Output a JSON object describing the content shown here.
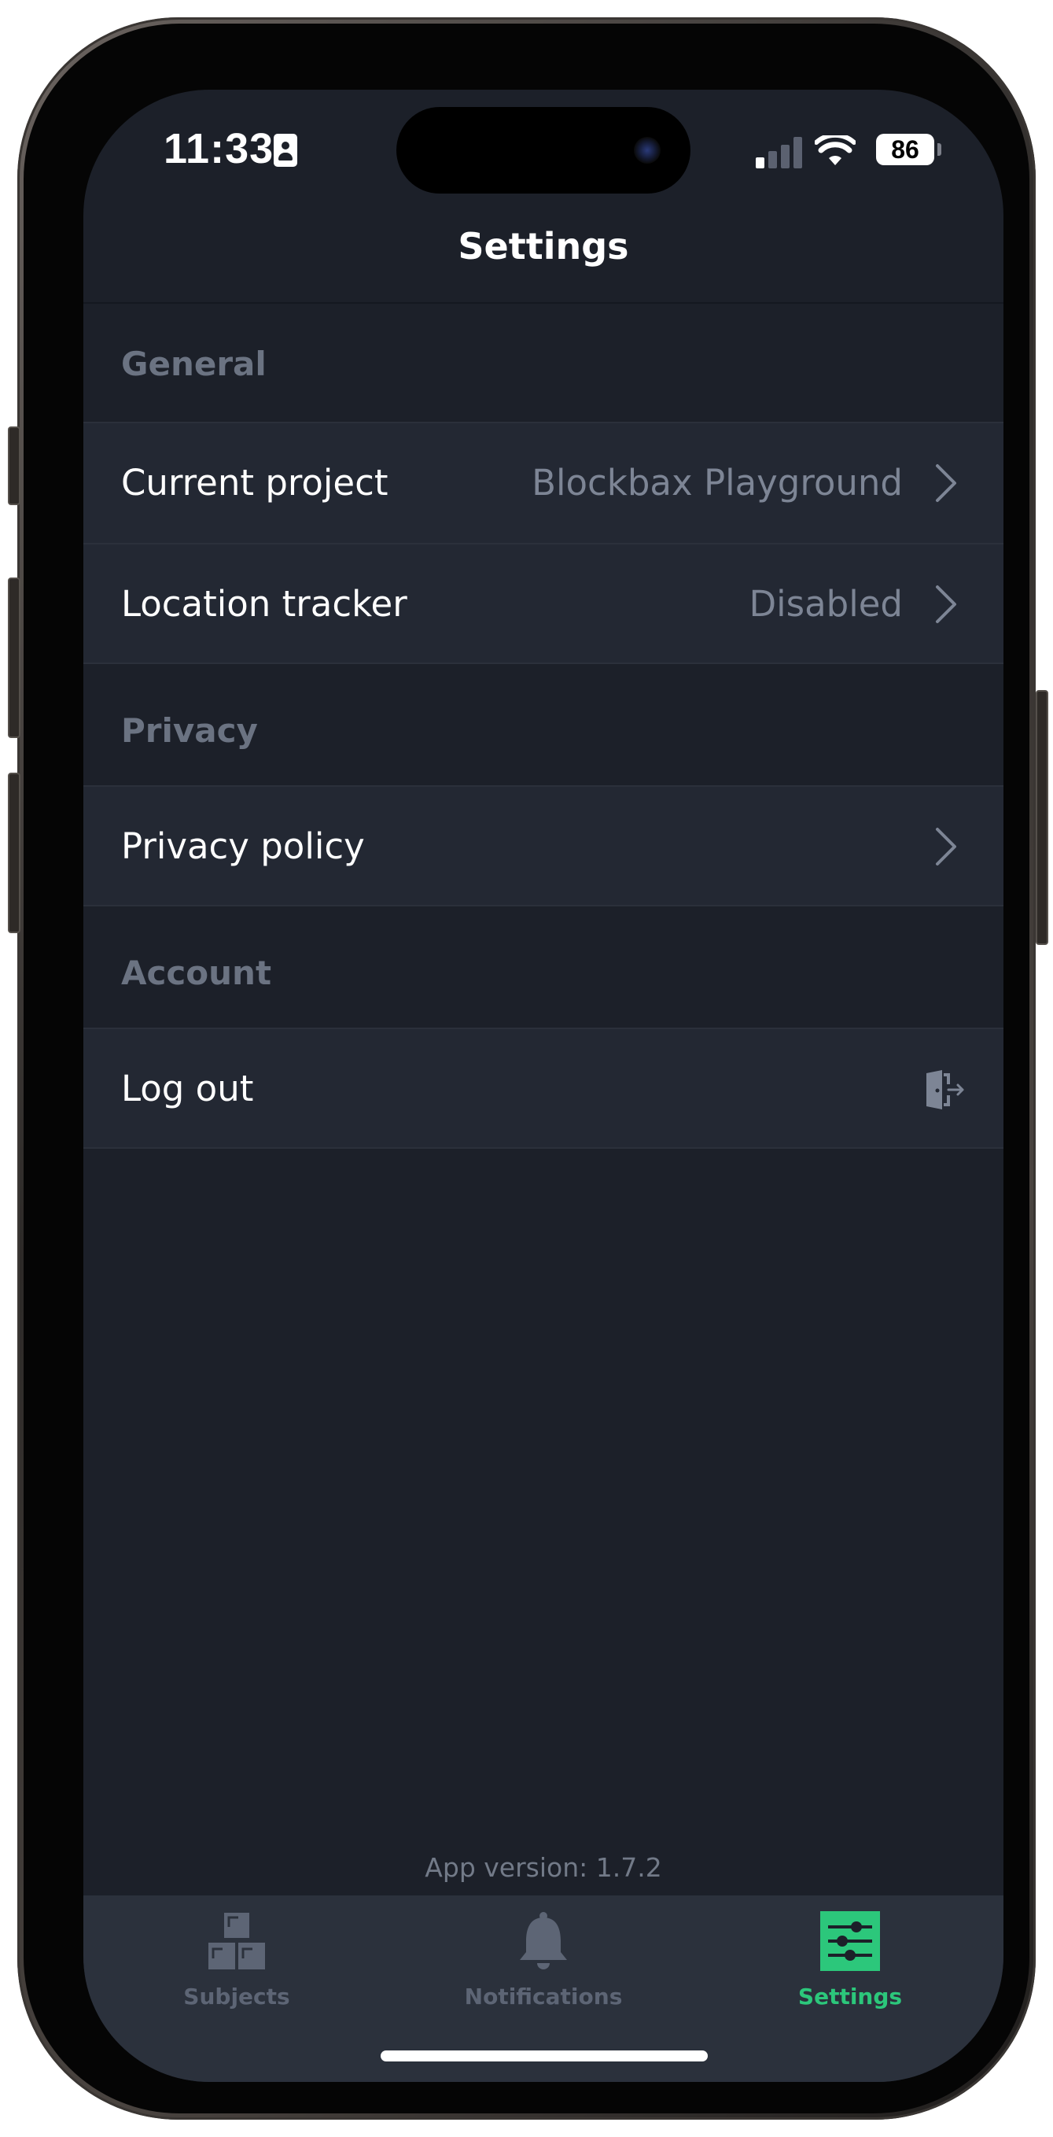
{
  "status_bar": {
    "time": "11:33",
    "battery": "86"
  },
  "header": {
    "title": "Settings"
  },
  "sections": {
    "general": {
      "title": "General",
      "current_project": {
        "label": "Current project",
        "value": "Blockbax Playground"
      },
      "location_tracker": {
        "label": "Location tracker",
        "value": "Disabled"
      }
    },
    "privacy": {
      "title": "Privacy",
      "privacy_policy": {
        "label": "Privacy policy"
      }
    },
    "account": {
      "title": "Account",
      "log_out": {
        "label": "Log out"
      }
    }
  },
  "footer": {
    "app_version": "App version: 1.7.2"
  },
  "tabbar": {
    "tabs": [
      {
        "label": "Subjects",
        "icon": "boxes-icon",
        "active": false
      },
      {
        "label": "Notifications",
        "icon": "bell-icon",
        "active": false
      },
      {
        "label": "Settings",
        "icon": "sliders-icon",
        "active": true
      }
    ]
  },
  "colors": {
    "background": "#1c2029",
    "row": "#232833",
    "accent": "#2cc77b",
    "muted_text": "#7d8595"
  }
}
